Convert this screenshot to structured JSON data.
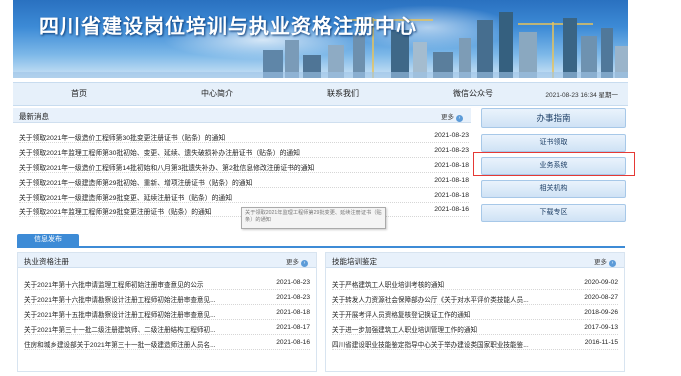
{
  "site": {
    "title": "四川省建设岗位培训与执业资格注册中心"
  },
  "nav": {
    "items": [
      "首页",
      "中心简介",
      "联系我们",
      "微信公众号"
    ],
    "datetime": "2021-08-23 16:34 星期一"
  },
  "news": {
    "title": "最新消息",
    "more": "更多",
    "rows": [
      {
        "title": "关于领取2021年一级造价工程师第30批变更注册证书（贴条）的通知",
        "date": "2021-08-23"
      },
      {
        "title": "关于领取2021年监理工程师第30批初始、变更、延续、遗失破损补办注册证书（贴条）的通知",
        "date": "2021-08-23"
      },
      {
        "title": "关于领取2021年一级造价工程师第14批初始和八月第3批遗失补办、第2批信息修改注册证书的通知",
        "date": "2021-08-18"
      },
      {
        "title": "关于领取2021年一级建造师第29批初始、重新、增项注册证书（贴条）的通知",
        "date": "2021-08-18"
      },
      {
        "title": "关于领取2021年一级建造师第29批变更、延续注册证书（贴条）的通知",
        "date": "2021-08-18"
      },
      {
        "title": "关于领取2021年监理工程师第29批变更注册证书（贴条）的通知",
        "date": "2021-08-16"
      }
    ]
  },
  "tooltip": "关于领取2021年监理工程师第29批变更、延续注册证书（贴条）的通知",
  "side": {
    "buttons": [
      "办事指南",
      "证书领取",
      "业务系统",
      "相关机构",
      "下载专区"
    ]
  },
  "info_tab": "信息发布",
  "left_panel": {
    "title": "执业资格注册",
    "more": "更多",
    "rows": [
      {
        "title": "关于2021年第十六批申请监理工程师初始注册审查意见的公示",
        "date": "2021-08-23"
      },
      {
        "title": "关于2021年第十六批申请勘察设计注册工程师初始注册审查意见...",
        "date": "2021-08-23"
      },
      {
        "title": "关于2021年第十五批申请勘察设计注册工程师初始注册审查意见...",
        "date": "2021-08-18"
      },
      {
        "title": "关于2021年第三十一批二级注册建筑师、二级注册结构工程师初...",
        "date": "2021-08-17"
      },
      {
        "title": "住房和城乡建设部关于2021年第三十一批一级建造师注册人员名...",
        "date": "2021-08-16"
      }
    ]
  },
  "right_panel": {
    "title": "技能培训鉴定",
    "more": "更多",
    "rows": [
      {
        "title": "关于严格建筑工人职业培训考核的通知",
        "date": "2020-09-02"
      },
      {
        "title": "关于转发人力资源社会保障部办公厅《关于对水平评价类技能人员...",
        "date": "2020-08-27"
      },
      {
        "title": "关于开展考评人员资格复核登记换证工作的通知",
        "date": "2018-09-26"
      },
      {
        "title": "关于进一步加强建筑工人职业培训管理工作的通知",
        "date": "2017-09-13"
      },
      {
        "title": "四川省建设职业技能鉴定指导中心关于举办建设类国家职业技能鉴...",
        "date": "2016-11-15"
      }
    ]
  }
}
